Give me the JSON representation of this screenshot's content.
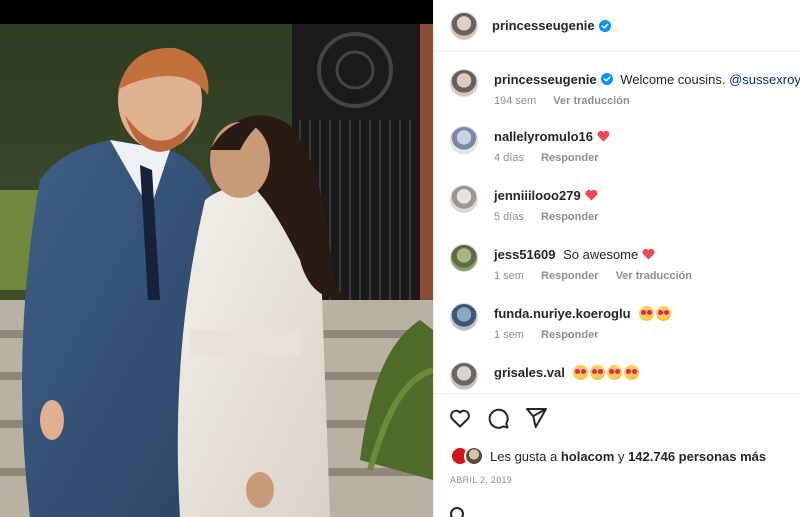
{
  "colors": {
    "accent_blue": "#0095f6",
    "heart_red": "#ed4956",
    "meta_gray": "#8e8e8e",
    "mention_blue": "#00376b"
  },
  "photo": {
    "alt_icon": "photo"
  },
  "post_header": {
    "username": "princesseugenie",
    "verified_icon": "verified-badge-icon"
  },
  "comments": [
    {
      "user": "princesseugenie",
      "text": "Welcome cousins.",
      "mention": "@sussexroyal",
      "verified": true,
      "time": "194 sem",
      "action": "Ver traducción"
    },
    {
      "user": "nallelyromulo16",
      "heart": true,
      "time": "4 días",
      "action": "Responder"
    },
    {
      "user": "jenniiilooo279",
      "heart": true,
      "time": "5 días",
      "action": "Responder"
    },
    {
      "user": "jess51609",
      "text": "So awesome",
      "heart": true,
      "time": "1 sem",
      "action": "Responder",
      "action2": "Ver traducción"
    },
    {
      "user": "funda.nuriye.koeroglu",
      "emoji_count": 2,
      "time": "1 sem",
      "action": "Responder"
    },
    {
      "user": "grisales.val",
      "emoji_count": 4
    }
  ],
  "actions": {
    "like_icon": "heart-outline-icon",
    "comment_icon": "comment-icon",
    "share_icon": "share-icon"
  },
  "likes": {
    "prefix": "Les gusta a",
    "user": "holacom",
    "connector": "y",
    "count": "142.746 personas más"
  },
  "date": "ABRIL 2, 2019"
}
